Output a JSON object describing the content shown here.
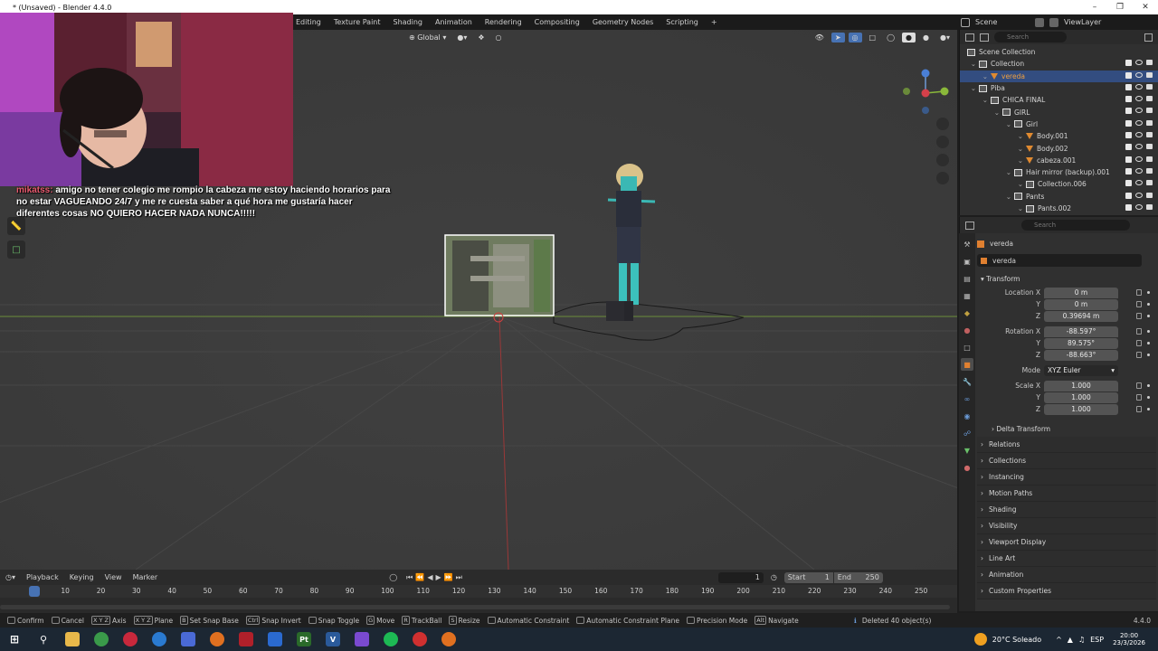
{
  "window": {
    "title": "* (Unsaved) - Blender 4.4.0"
  },
  "workspace_tabs": [
    "Editing",
    "Texture Paint",
    "Shading",
    "Animation",
    "Rendering",
    "Compositing",
    "Geometry Nodes",
    "Scripting"
  ],
  "scene": {
    "scene_name": "Scene",
    "view_layer": "ViewLayer"
  },
  "viewport_header": {
    "orientation": "Global"
  },
  "chat": {
    "username": "mikatss:",
    "message": "amigo no tener colegio me rompio la cabeza me estoy haciendo horarios para no estar VAGUEANDO 24/7 y me re cuesta saber a qué hora me gustaría hacer diferentes cosas NO QUIERO HACER NADA NUNCA!!!!!"
  },
  "outliner": {
    "search_placeholder": "Search",
    "items": [
      {
        "label": "Scene Collection",
        "depth": 0,
        "icon": "collection-icon"
      },
      {
        "label": "Collection",
        "depth": 1,
        "icon": "collection-icon"
      },
      {
        "label": "vereda",
        "depth": 2,
        "icon": "mesh-icon",
        "selected": true
      },
      {
        "label": "Piba",
        "depth": 1,
        "icon": "collection-icon"
      },
      {
        "label": "CHICA FINAL",
        "depth": 2,
        "icon": "collection-icon"
      },
      {
        "label": "GIRL",
        "depth": 3,
        "icon": "collection-icon"
      },
      {
        "label": "Girl",
        "depth": 4,
        "icon": "collection-icon"
      },
      {
        "label": "Body.001",
        "depth": 5,
        "icon": "mesh-icon"
      },
      {
        "label": "Body.002",
        "depth": 5,
        "icon": "mesh-icon"
      },
      {
        "label": "cabeza.001",
        "depth": 5,
        "icon": "mesh-icon"
      },
      {
        "label": "Hair mirror (backup).001",
        "depth": 4,
        "icon": "collection-icon"
      },
      {
        "label": "Collection.006",
        "depth": 5,
        "icon": "collection-icon"
      },
      {
        "label": "Pants",
        "depth": 4,
        "icon": "collection-icon"
      },
      {
        "label": "Pants.002",
        "depth": 5,
        "icon": "collection-icon"
      }
    ]
  },
  "properties": {
    "search_placeholder": "Search",
    "object_name": "vereda",
    "object_field": "vereda",
    "transform_label": "Transform",
    "location": {
      "label": "Location X",
      "x": "0 m",
      "y": "0 m",
      "z": "0.39694 m"
    },
    "rotation": {
      "label": "Rotation X",
      "x": "-88.597°",
      "y": "89.575°",
      "z": "-88.663°"
    },
    "mode": {
      "label": "Mode",
      "value": "XYZ Euler"
    },
    "scale": {
      "label": "Scale X",
      "x": "1.000",
      "y": "1.000",
      "z": "1.000"
    },
    "axis_y": "Y",
    "axis_z": "Z",
    "delta": "Delta Transform",
    "sections": [
      "Relations",
      "Collections",
      "Instancing",
      "Motion Paths",
      "Shading",
      "Visibility",
      "Viewport Display",
      "Line Art",
      "Animation",
      "Custom Properties"
    ]
  },
  "timeline": {
    "menus": [
      "Playback",
      "Keying",
      "View",
      "Marker"
    ],
    "current_frame": "1",
    "start_label": "Start",
    "start": "1",
    "end_label": "End",
    "end": "250",
    "ticks": [
      "1",
      "10",
      "20",
      "30",
      "40",
      "50",
      "60",
      "70",
      "80",
      "90",
      "100",
      "110",
      "120",
      "130",
      "140",
      "150",
      "160",
      "170",
      "180",
      "190",
      "200",
      "210",
      "220",
      "230",
      "240",
      "250"
    ],
    "playhead_frame": 1
  },
  "statusbar": {
    "items": [
      {
        "key": "",
        "label": "Confirm"
      },
      {
        "key": "",
        "label": "Cancel"
      },
      {
        "key": "X Y Z",
        "label": "Axis"
      },
      {
        "key": "X Y Z",
        "label": "Plane"
      },
      {
        "key": "B",
        "label": "Set Snap Base"
      },
      {
        "key": "Ctrl",
        "label": "Snap Invert"
      },
      {
        "key": "",
        "label": "Snap Toggle"
      },
      {
        "key": "G",
        "label": "Move"
      },
      {
        "key": "R",
        "label": "TrackBall"
      },
      {
        "key": "S",
        "label": "Resize"
      },
      {
        "key": "",
        "label": "Automatic Constraint"
      },
      {
        "key": "",
        "label": "Automatic Constraint Plane"
      },
      {
        "key": "",
        "label": "Precision Mode"
      },
      {
        "key": "Alt",
        "label": "Navigate"
      }
    ],
    "message": "Deleted 40 object(s)",
    "version": "4.4.0"
  },
  "taskbar": {
    "weather": "20°C Soleado",
    "language": "ESP",
    "time": "20:00",
    "date": "23/3/2026"
  }
}
